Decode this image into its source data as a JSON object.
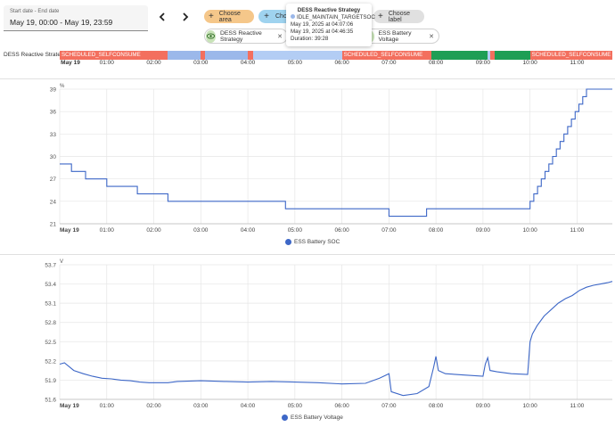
{
  "date_range": {
    "label": "Start date - End date",
    "value": "May 19, 00:00 - May 19, 23:59"
  },
  "nav": {
    "prev_icon": "chevron-left-icon",
    "next_icon": "chevron-right-icon"
  },
  "filters": {
    "area_label": "Choose area",
    "entity_label": "Choo",
    "label_label": "Choose label"
  },
  "selected_entities": [
    {
      "name": "DESS Reactive Strategy"
    },
    {
      "name": "ESS Battery Voltage"
    }
  ],
  "tooltip": {
    "title": "DESS Reactive Strategy",
    "state": "IDLE_MAINTAIN_TARGETSOC",
    "start": "May 19, 2025 at 04:07:06",
    "end": "May 19, 2025 at 04:46:35",
    "duration": "Duration: 39:28"
  },
  "timeline": {
    "entity_label": "DESS Reactive Strategy",
    "segments": [
      {
        "state": "SCHEDULED_SELFCONSUME",
        "start": 0.0,
        "end": 2.3,
        "color": "#f36f5e",
        "label": "SCHEDULED_SELFCONSUME"
      },
      {
        "state": "IDLE",
        "start": 2.3,
        "end": 3.0,
        "color": "#9bb8ea",
        "label": ""
      },
      {
        "state": "SCHEDULED_SELFCONSUME",
        "start": 3.0,
        "end": 3.08,
        "color": "#f36f5e",
        "label": ""
      },
      {
        "state": "IDLE",
        "start": 3.08,
        "end": 4.0,
        "color": "#9bb8ea",
        "label": ""
      },
      {
        "state": "SCHEDULED_SELFCONSUME",
        "start": 4.0,
        "end": 4.12,
        "color": "#f36f5e",
        "label": ""
      },
      {
        "state": "IDLE_MAINTAIN_TARGETSOC",
        "start": 4.12,
        "end": 6.0,
        "color": "#b3cdf4",
        "label": ""
      },
      {
        "state": "SCHEDULED_SELFCONSUME",
        "start": 6.0,
        "end": 7.9,
        "color": "#f36f5e",
        "label": "SCHEDULED_SELFCONSUME"
      },
      {
        "state": "CHARGE",
        "start": 7.9,
        "end": 9.1,
        "color": "#1e9e55",
        "label": ""
      },
      {
        "state": "IDLE",
        "start": 9.1,
        "end": 9.15,
        "color": "#b3cdf4",
        "label": ""
      },
      {
        "state": "SCHEDULED_SELFCONSUME",
        "start": 9.15,
        "end": 9.25,
        "color": "#f36f5e",
        "label": ""
      },
      {
        "state": "CHARGE",
        "start": 9.25,
        "end": 10.0,
        "color": "#1e9e55",
        "label": ""
      },
      {
        "state": "SCHEDULED_SELFCONSUME",
        "start": 10.0,
        "end": 11.75,
        "color": "#f36f5e",
        "label": "SCHEDULED_SELFCONSUME"
      }
    ]
  },
  "x_ticks": [
    "May 19",
    "01:00",
    "02:00",
    "03:00",
    "04:00",
    "05:00",
    "06:00",
    "07:00",
    "08:00",
    "09:00",
    "10:00",
    "11:00"
  ],
  "chart_data": [
    {
      "type": "line",
      "title": "",
      "unit": "%",
      "ylim": [
        21,
        39
      ],
      "yticks": [
        "39",
        "36",
        "33",
        "30",
        "27",
        "24",
        "21"
      ],
      "xlim_hours": [
        0,
        11.75
      ],
      "series": [
        {
          "name": "ESS Battery SOC",
          "color": "#3d67c7",
          "x": [
            0,
            0.25,
            0.25,
            0.55,
            0.55,
            1.0,
            1.0,
            1.65,
            1.65,
            2.3,
            2.3,
            4.8,
            4.8,
            7.0,
            7.0,
            7.8,
            7.8,
            10.0,
            10.0,
            10.08,
            10.08,
            10.16,
            10.16,
            10.24,
            10.24,
            10.32,
            10.32,
            10.4,
            10.4,
            10.48,
            10.48,
            10.56,
            10.56,
            10.64,
            10.64,
            10.72,
            10.72,
            10.8,
            10.8,
            10.88,
            10.88,
            10.96,
            10.96,
            11.04,
            11.04,
            11.12,
            11.12,
            11.2,
            11.2,
            11.28,
            11.28,
            11.36,
            11.36,
            11.44,
            11.44,
            11.52,
            11.52,
            11.6,
            11.6,
            11.68,
            11.68,
            11.75
          ],
          "y": [
            29,
            29,
            28,
            28,
            27,
            27,
            26,
            26,
            25,
            25,
            24,
            24,
            23,
            23,
            22,
            22,
            23,
            23,
            24,
            24,
            25,
            25,
            26,
            26,
            27,
            27,
            28,
            28,
            29,
            29,
            30,
            30,
            31,
            31,
            32,
            32,
            33,
            33,
            34,
            34,
            35,
            35,
            36,
            36,
            37,
            37,
            38,
            38,
            39,
            39,
            39,
            39,
            39,
            39,
            39,
            39,
            39,
            39,
            39,
            39,
            39,
            39
          ]
        }
      ]
    },
    {
      "type": "line",
      "title": "",
      "unit": "V",
      "ylim": [
        51.6,
        53.7
      ],
      "yticks": [
        "53.7",
        "53.4",
        "53.1",
        "52.8",
        "52.5",
        "52.2",
        "51.9",
        "51.6"
      ],
      "xlim_hours": [
        0,
        11.75
      ],
      "series": [
        {
          "name": "ESS Battery Voltage",
          "color": "#3d67c7",
          "x": [
            0,
            0.1,
            0.3,
            0.5,
            0.7,
            0.9,
            1.1,
            1.3,
            1.5,
            1.7,
            1.9,
            2.1,
            2.3,
            2.5,
            3.0,
            3.5,
            4.0,
            4.5,
            5.0,
            5.5,
            6.0,
            6.5,
            6.8,
            7.0,
            7.05,
            7.3,
            7.6,
            7.85,
            7.95,
            8.0,
            8.05,
            8.2,
            8.6,
            9.0,
            9.05,
            9.1,
            9.15,
            9.3,
            9.6,
            9.95,
            10.0,
            10.05,
            10.15,
            10.3,
            10.45,
            10.6,
            10.75,
            10.9,
            11.05,
            11.2,
            11.35,
            11.5,
            11.65,
            11.75
          ],
          "y": [
            52.15,
            52.17,
            52.05,
            52.0,
            51.96,
            51.93,
            51.92,
            51.9,
            51.89,
            51.87,
            51.86,
            51.86,
            51.86,
            51.88,
            51.89,
            51.88,
            51.87,
            51.88,
            51.87,
            51.86,
            51.84,
            51.85,
            51.93,
            52.0,
            51.72,
            51.66,
            51.69,
            51.8,
            52.1,
            52.27,
            52.05,
            52.0,
            51.98,
            51.96,
            52.15,
            52.25,
            52.05,
            52.03,
            52.0,
            51.99,
            52.5,
            52.62,
            52.75,
            52.9,
            53.0,
            53.1,
            53.17,
            53.22,
            53.3,
            53.35,
            53.38,
            53.4,
            53.42,
            53.44
          ]
        }
      ]
    }
  ],
  "legend": {
    "soc": "ESS Battery SOC",
    "voltage": "ESS Battery Voltage"
  }
}
